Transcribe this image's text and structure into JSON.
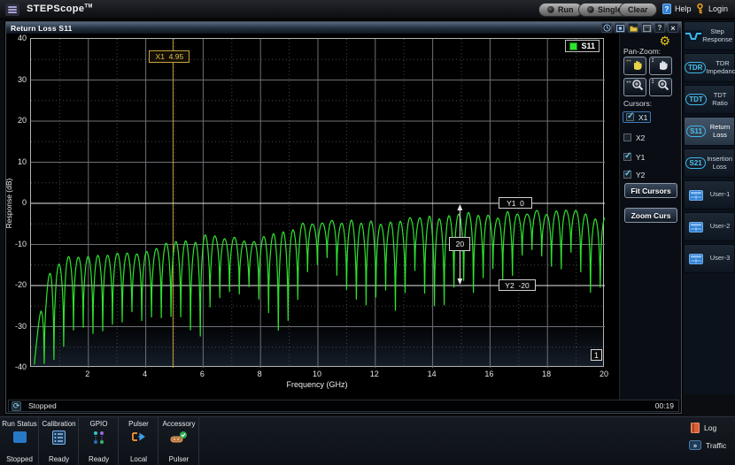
{
  "app": {
    "title": "STEPScope",
    "title_suffix": "TM"
  },
  "topbar": {
    "run_label": "Run",
    "single_label": "Single",
    "clear_label": "Clear",
    "help_label": "Help",
    "login_label": "Login",
    "icons": [
      "hamburger-icon",
      "run-led",
      "single-led",
      "help-icon",
      "key-icon"
    ]
  },
  "window": {
    "title": "Return Loss S11",
    "titlebar_icons": [
      "clock-icon",
      "snapshot-icon",
      "folder-icon",
      "save-icon",
      "help-icon",
      "close-icon"
    ]
  },
  "chart": {
    "type": "line",
    "xlabel": "Frequency (GHz)",
    "ylabel": "Response (dB)",
    "xlim": [
      0,
      20
    ],
    "ylim": [
      -40,
      40
    ],
    "x_ticks": [
      2,
      4,
      6,
      8,
      10,
      12,
      14,
      16,
      18,
      20
    ],
    "y_ticks": [
      40,
      30,
      20,
      10,
      0,
      -10,
      -20,
      -30,
      -40
    ],
    "grid": {
      "major_color": "#6f6f76",
      "minor_color": "#46464e"
    },
    "legend": [
      {
        "label": "S11",
        "color": "#2ee32e"
      }
    ],
    "page_badge": "1",
    "trace": {
      "name": "S11",
      "color": "#2ee32e",
      "f_start": 0.12,
      "ripple_period_ghz": 0.34,
      "dip_sharpness": 0.45,
      "peak_env": [
        [
          0.12,
          -37
        ],
        [
          0.35,
          -26
        ],
        [
          0.7,
          -16
        ],
        [
          1.2,
          -13
        ],
        [
          2,
          -12.5
        ],
        [
          3,
          -12
        ],
        [
          4,
          -11.5
        ],
        [
          4.8,
          -10
        ],
        [
          5.6,
          -9
        ],
        [
          6.4,
          -7.5
        ],
        [
          7,
          -8.5
        ],
        [
          7.6,
          -9
        ],
        [
          8.2,
          -7.5
        ],
        [
          9,
          -6
        ],
        [
          9.6,
          -4.5
        ],
        [
          10.4,
          -4
        ],
        [
          11,
          -4.5
        ],
        [
          11.8,
          -5
        ],
        [
          12.4,
          -5
        ],
        [
          13,
          -4
        ],
        [
          13.6,
          -3.5
        ],
        [
          14.4,
          -3
        ],
        [
          15.2,
          -3
        ],
        [
          16,
          -3.2
        ],
        [
          16.8,
          -2.6
        ],
        [
          17.6,
          -2
        ],
        [
          18.4,
          -2
        ],
        [
          19.2,
          -2.6
        ],
        [
          20,
          -4
        ]
      ],
      "dip_env": [
        [
          0.12,
          -40
        ],
        [
          0.9,
          -39.5
        ],
        [
          1.6,
          -31
        ],
        [
          2.2,
          -34
        ],
        [
          2.8,
          -31
        ],
        [
          3.4,
          -29
        ],
        [
          4,
          -31
        ],
        [
          4.6,
          -28
        ],
        [
          5.2,
          -30
        ],
        [
          5.9,
          -35
        ],
        [
          6.4,
          -25
        ],
        [
          7,
          -22
        ],
        [
          7.6,
          -23
        ],
        [
          8.2,
          -26
        ],
        [
          8.7,
          -32
        ],
        [
          9.2,
          -27
        ],
        [
          9.7,
          -18
        ],
        [
          10.3,
          -16
        ],
        [
          10.9,
          -20
        ],
        [
          11.4,
          -27
        ],
        [
          11.9,
          -25
        ],
        [
          12.4,
          -21
        ],
        [
          12.8,
          -29
        ],
        [
          13.3,
          -15
        ],
        [
          13.9,
          -26
        ],
        [
          14.4,
          -26
        ],
        [
          14.9,
          -21
        ],
        [
          15.5,
          -22
        ],
        [
          16.1,
          -17
        ],
        [
          16.7,
          -20
        ],
        [
          17.3,
          -12
        ],
        [
          17.9,
          -14
        ],
        [
          18.4,
          -19
        ],
        [
          18.9,
          -13
        ],
        [
          19.4,
          -22
        ],
        [
          20,
          -23
        ]
      ]
    }
  },
  "cursors": {
    "x1": {
      "label": "X1  4.95",
      "ghz": 4.95,
      "color": "#c9a23c"
    },
    "y1": {
      "label": "Y1  0",
      "db": 0
    },
    "y2": {
      "label": "Y2  -20",
      "db": -20
    },
    "delta": {
      "label": "20",
      "at_ghz": 14.95
    }
  },
  "panel": {
    "gear_icon": "gear-icon",
    "pan_zoom_label": "Pan-Zoom:",
    "pan_zoom_buttons": [
      {
        "icon": "pan-horizontal-icon",
        "active": true
      },
      {
        "icon": "pan-vertical-icon",
        "active": false
      },
      {
        "icon": "zoom-horizontal-icon",
        "active": false
      },
      {
        "icon": "zoom-vertical-icon",
        "active": false
      }
    ],
    "cursors_label": "Cursors:",
    "checkboxes": [
      {
        "label": "X1",
        "checked": true,
        "selected": true
      },
      {
        "label": "X2",
        "checked": false,
        "selected": false
      },
      {
        "label": "Y1",
        "checked": true,
        "selected": false
      },
      {
        "label": "Y2",
        "checked": true,
        "selected": false
      }
    ],
    "fit_button": "Fit Cursors",
    "zoom_button": "Zoom Curs"
  },
  "statusbar": {
    "icon": "refresh-icon",
    "status": "Stopped",
    "time": "00:19"
  },
  "side_tabs": [
    {
      "id": "step-response",
      "icon": "step-response-icon",
      "lines": [
        "Step",
        "Response"
      ],
      "active": false
    },
    {
      "id": "tdr-impedance",
      "badge": "TDR",
      "lines": [
        "TDR",
        "Impedance"
      ],
      "active": false
    },
    {
      "id": "tdt-ratio",
      "badge": "TDT",
      "lines": [
        "TDT Ratio"
      ],
      "active": false
    },
    {
      "id": "return-loss",
      "badge": "S11",
      "lines": [
        "Return",
        "Loss"
      ],
      "active": true
    },
    {
      "id": "insertion-loss",
      "badge": "S21",
      "lines": [
        "Insertion",
        "Loss"
      ],
      "active": false
    },
    {
      "id": "user-1",
      "icon": "user-window-icon",
      "lines": [
        "User-1"
      ],
      "active": false
    },
    {
      "id": "user-2",
      "icon": "user-window-icon",
      "lines": [
        "User-2"
      ],
      "active": false
    },
    {
      "id": "user-3",
      "icon": "user-window-icon",
      "lines": [
        "User-3"
      ],
      "active": false
    }
  ],
  "dock": {
    "sections": [
      {
        "title": "Run Status",
        "value": "Stopped",
        "icon": "run-status-icon"
      },
      {
        "title": "Calibration",
        "value": "Ready",
        "icon": "calibration-icon"
      },
      {
        "title": "GPIO",
        "value": "Ready",
        "icon": "gpio-icon"
      },
      {
        "title": "Pulser",
        "value": "Local",
        "icon": "pulser-icon"
      },
      {
        "title": "Accessory",
        "value": "Pulser",
        "icon": "accessory-icon"
      }
    ],
    "log_label": "Log",
    "traffic_label": "Traffic"
  }
}
